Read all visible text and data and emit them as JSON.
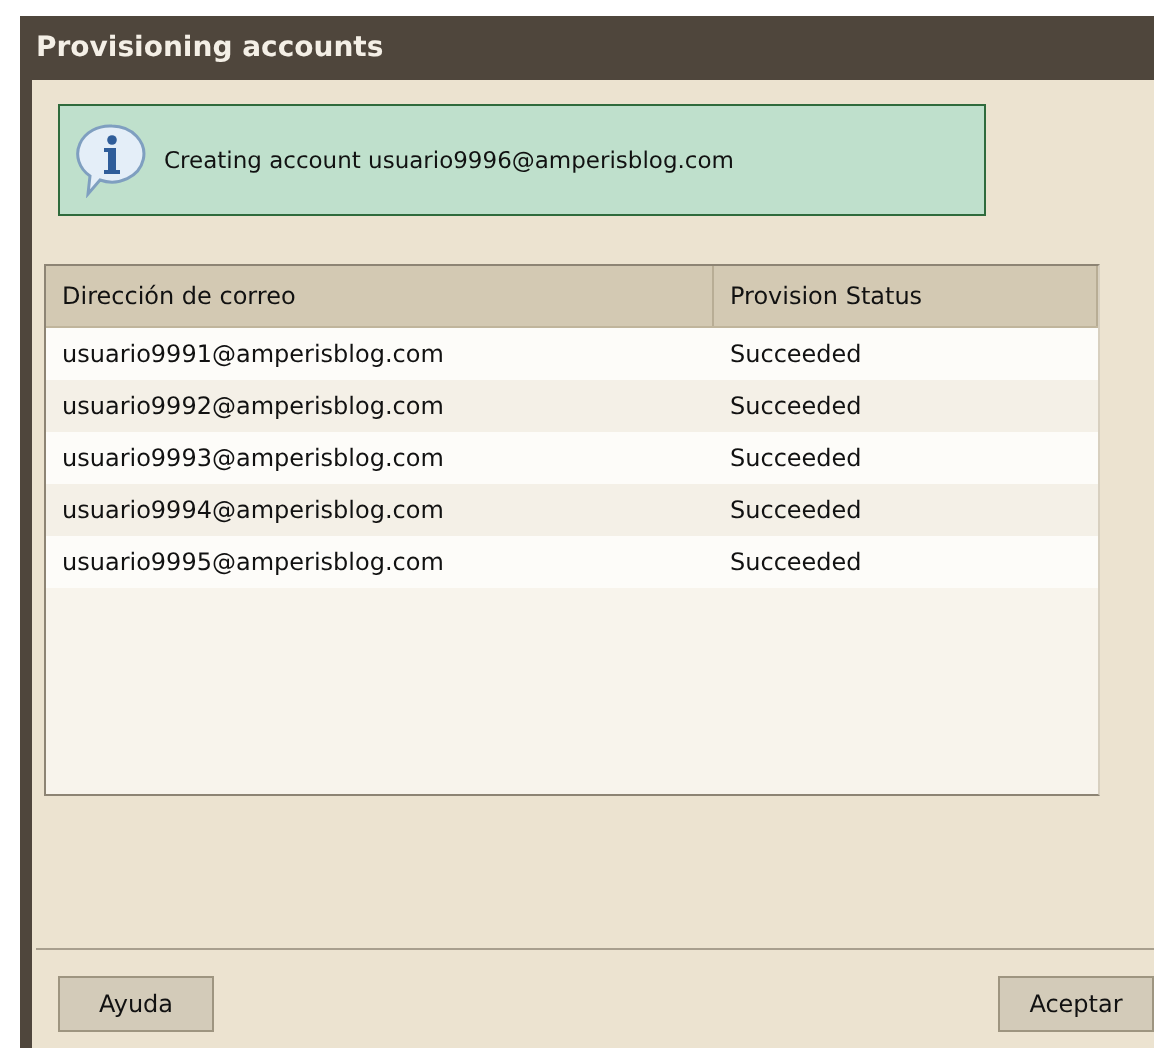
{
  "window": {
    "title": "Provisioning accounts"
  },
  "message": {
    "text": "Creating account usuario9996@amperisblog.com"
  },
  "table": {
    "columns": [
      "Dirección de correo",
      "Provision Status"
    ],
    "rows": [
      [
        "usuario9991@amperisblog.com",
        "Succeeded"
      ],
      [
        "usuario9992@amperisblog.com",
        "Succeeded"
      ],
      [
        "usuario9993@amperisblog.com",
        "Succeeded"
      ],
      [
        "usuario9994@amperisblog.com",
        "Succeeded"
      ],
      [
        "usuario9995@amperisblog.com",
        "Succeeded"
      ]
    ]
  },
  "buttons": {
    "help": "Ayuda",
    "ok": "Aceptar"
  }
}
